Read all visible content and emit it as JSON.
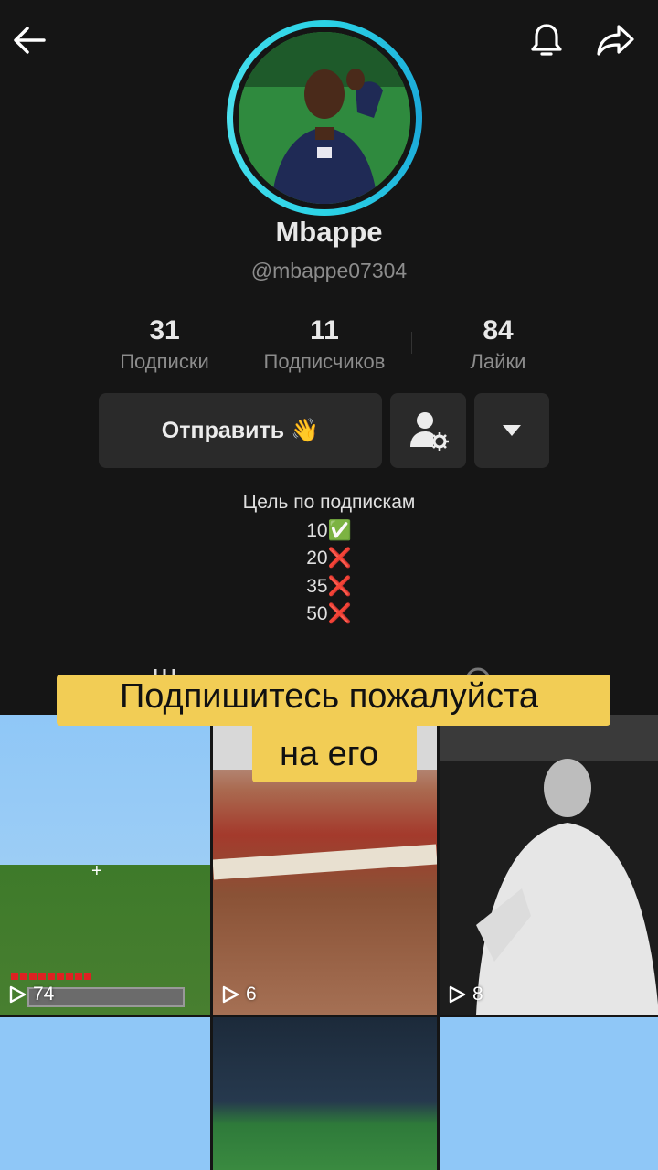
{
  "header": {
    "back_icon": "arrow-left-icon",
    "bell_icon": "bell-icon",
    "share_icon": "share-arrow-icon"
  },
  "profile": {
    "name": "Mbappe",
    "handle": "@mbappe07304",
    "avatar_ring_color": "#2bd3e6"
  },
  "stats": [
    {
      "value": "31",
      "label": "Подписки"
    },
    {
      "value": "11",
      "label": "Подписчиков"
    },
    {
      "value": "84",
      "label": "Лайки"
    }
  ],
  "actions": {
    "send_label": "Отправить 👋",
    "friend_icon": "person-gear-icon",
    "more_icon": "caret-down-icon"
  },
  "bio": {
    "title": "Цель по подпискам",
    "goals": [
      "10✅",
      "20❌",
      "35❌",
      "50❌"
    ]
  },
  "caption": {
    "line1": "Подпишитесь пожалуйста",
    "line2": "на его",
    "background": "#f2cd55"
  },
  "videos": [
    {
      "views": "74"
    },
    {
      "views": "6"
    },
    {
      "views": "8"
    },
    {
      "views": ""
    },
    {
      "views": ""
    },
    {
      "views": ""
    }
  ]
}
